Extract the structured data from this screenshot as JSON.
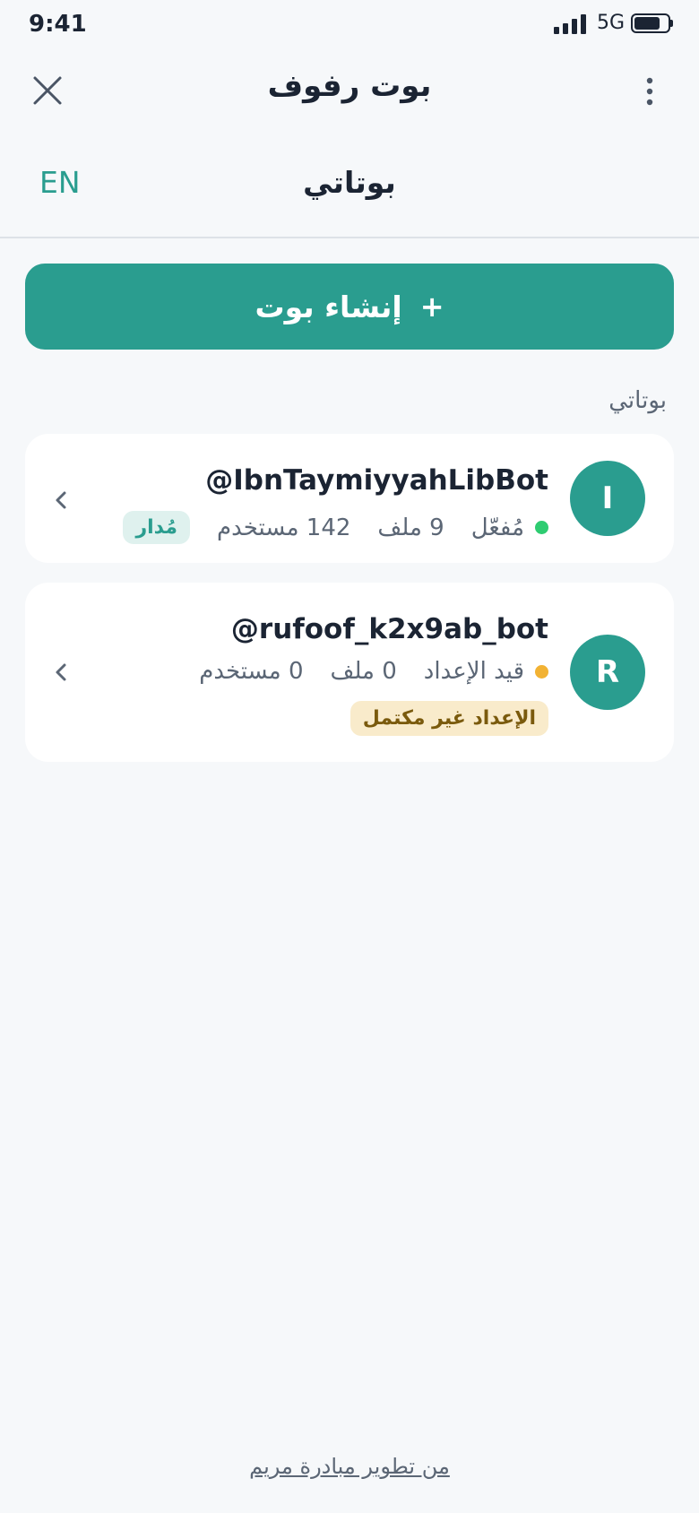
{
  "status_bar": {
    "time": "9:41",
    "network": "5G"
  },
  "header": {
    "title": "بوت رفوف",
    "close_icon": "close-icon",
    "menu_icon": "kebab-menu-icon"
  },
  "sub_header": {
    "title": "بوتاتي",
    "language_toggle": "EN"
  },
  "create_button": {
    "label": "إنشاء بوت",
    "icon": "+"
  },
  "bots_section": {
    "label": "بوتاتي",
    "bots": [
      {
        "initial": "I",
        "username": "@IbnTaymiyyahLibBot",
        "status": "مُفعّل",
        "files": "9 ملف",
        "users": "142 مستخدم",
        "badge": "مُدار"
      },
      {
        "initial": "R",
        "username": "@rufoof_k2x9ab_bot",
        "status": "قيد الإعداد",
        "files": "0 ملف",
        "users": "0 مستخدم",
        "badge": "الإعداد غير مكتمل"
      }
    ]
  },
  "footer": {
    "credit": "من تطوير مبادرة مريم"
  },
  "colors": {
    "brand": "#2a9d8f",
    "background": "#f6f8fa",
    "status_active": "#2ecc71",
    "status_pending": "#f2b233",
    "warning_badge_bg": "#f9ebcb"
  }
}
